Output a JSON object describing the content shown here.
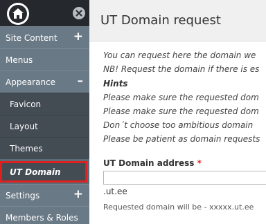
{
  "sidebar": {
    "home_icon": "home-icon",
    "close_icon": "close-icon",
    "items": [
      {
        "label": "Site Content",
        "toggle": "+"
      },
      {
        "label": "Menus"
      },
      {
        "label": "Appearance",
        "toggle": "–"
      },
      {
        "label": "Settings",
        "toggle": "+"
      },
      {
        "label": "Members & Roles"
      }
    ],
    "sub_items": [
      {
        "label": "Favicon"
      },
      {
        "label": "Layout"
      },
      {
        "label": "Themes"
      }
    ],
    "active_item": {
      "label": "UT Domain",
      "highlight_color": "#e0201f"
    }
  },
  "main": {
    "title": "UT Domain request",
    "intro": [
      "You can request here the domain we",
      "NB! Request the domain if there is es"
    ],
    "hints_title": "Hints",
    "hints": [
      "Please make sure the requested dom",
      "Please make sure the requested dom",
      "Don´t choose too ambitious domain",
      "Please be patient as domain requests"
    ],
    "field": {
      "label": "UT Domain address",
      "required_mark": "*",
      "value": "",
      "suffix": ".ut.ee",
      "description": "Requested domain will be - xxxxx.ut.ee"
    }
  },
  "colors": {
    "sidebar_top": "#25292d",
    "sidebar_item": "#6a7986",
    "sidebar_sub": "#434b53",
    "required": "#e0201f"
  }
}
